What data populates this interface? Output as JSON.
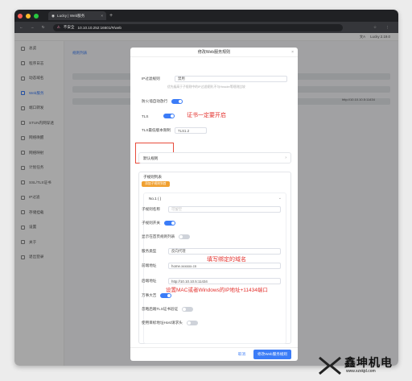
{
  "browser": {
    "tab_title": "Lucky | Web服务",
    "insecure_label": "不安全",
    "url": "10.10.10.252:16601/#/web"
  },
  "appbar": {
    "lang_icon": "translate-icon",
    "version": "Lucky 2.19.0"
  },
  "sidebar": {
    "items": [
      {
        "label": "总览",
        "icon": "home-icon"
      },
      {
        "label": "程序日志",
        "icon": "log-icon"
      },
      {
        "label": "动态域名",
        "icon": "ddns-icon"
      },
      {
        "label": "Web服务",
        "icon": "web-icon",
        "active": true
      },
      {
        "label": "端口转发",
        "icon": "port-icon"
      },
      {
        "label": "STUN内网穿透",
        "icon": "stun-icon"
      },
      {
        "label": "网络唤醒",
        "icon": "wol-icon"
      },
      {
        "label": "网络映射",
        "icon": "map-icon"
      },
      {
        "label": "计划任务",
        "icon": "schedule-icon"
      },
      {
        "label": "SSL/TLS证书",
        "icon": "cert-icon"
      },
      {
        "label": "IP过滤",
        "icon": "filter-icon"
      },
      {
        "label": "存储挂载",
        "icon": "storage-icon"
      },
      {
        "label": "设置",
        "icon": "settings-icon"
      },
      {
        "label": "关于",
        "icon": "about-icon"
      },
      {
        "label": "退出登录",
        "icon": "logout-icon"
      }
    ]
  },
  "background": {
    "tab_label": "规则列表",
    "cell_host": "http://10.10.10.5:11434"
  },
  "modal": {
    "title": "修改Web服务规则",
    "ip_filter_label": "IP过滤规则",
    "ip_filter_value": "禁用",
    "ip_filter_hint": "优先级高于子规则中的IP过滤规则,不与Header等规则比较",
    "firewall_label": "防火墙自动放行",
    "tls_label": "TLS",
    "tls_min_label": "TLS最低版本限制",
    "tls_min_value": "TLS1.2",
    "default_rule_label": "默认规则",
    "subrules_label": "子规则列表",
    "add_subrule_btn": "添加子规则到首",
    "sub_title": "No.1 ( )",
    "sub_name_label": "子规则名称",
    "sub_name_placeholder": "可留空",
    "sub_switch_label": "子规则开关",
    "show_in_home_label": "显示在首页规则列表",
    "service_type_label": "服务类型",
    "service_type_value": "反向代理",
    "frontend_label": "前端地址",
    "frontend_value": "home.xxxxxx.cn",
    "backend_label": "后端地址",
    "backend_value": "http://10.10.10.5:11434",
    "universal_label": "万事大吉",
    "ignore_tls_label": "忽略后端TLS证书验证",
    "use_target_host_label": "使用目标地址Host请求头",
    "cancel_btn": "取消",
    "submit_btn": "修改Web服务规则"
  },
  "annotations": {
    "tls_note": "证书一定要开启",
    "domain_note": "填写绑定的域名",
    "backend_note": "设置MAC或者Windows的IP地址+11434端口"
  },
  "watermark": {
    "brand": "鑫坤机电",
    "site": "www.xzxkjd.com"
  },
  "colors": {
    "accent": "#3b7cf7",
    "annotation": "#e3312d"
  }
}
